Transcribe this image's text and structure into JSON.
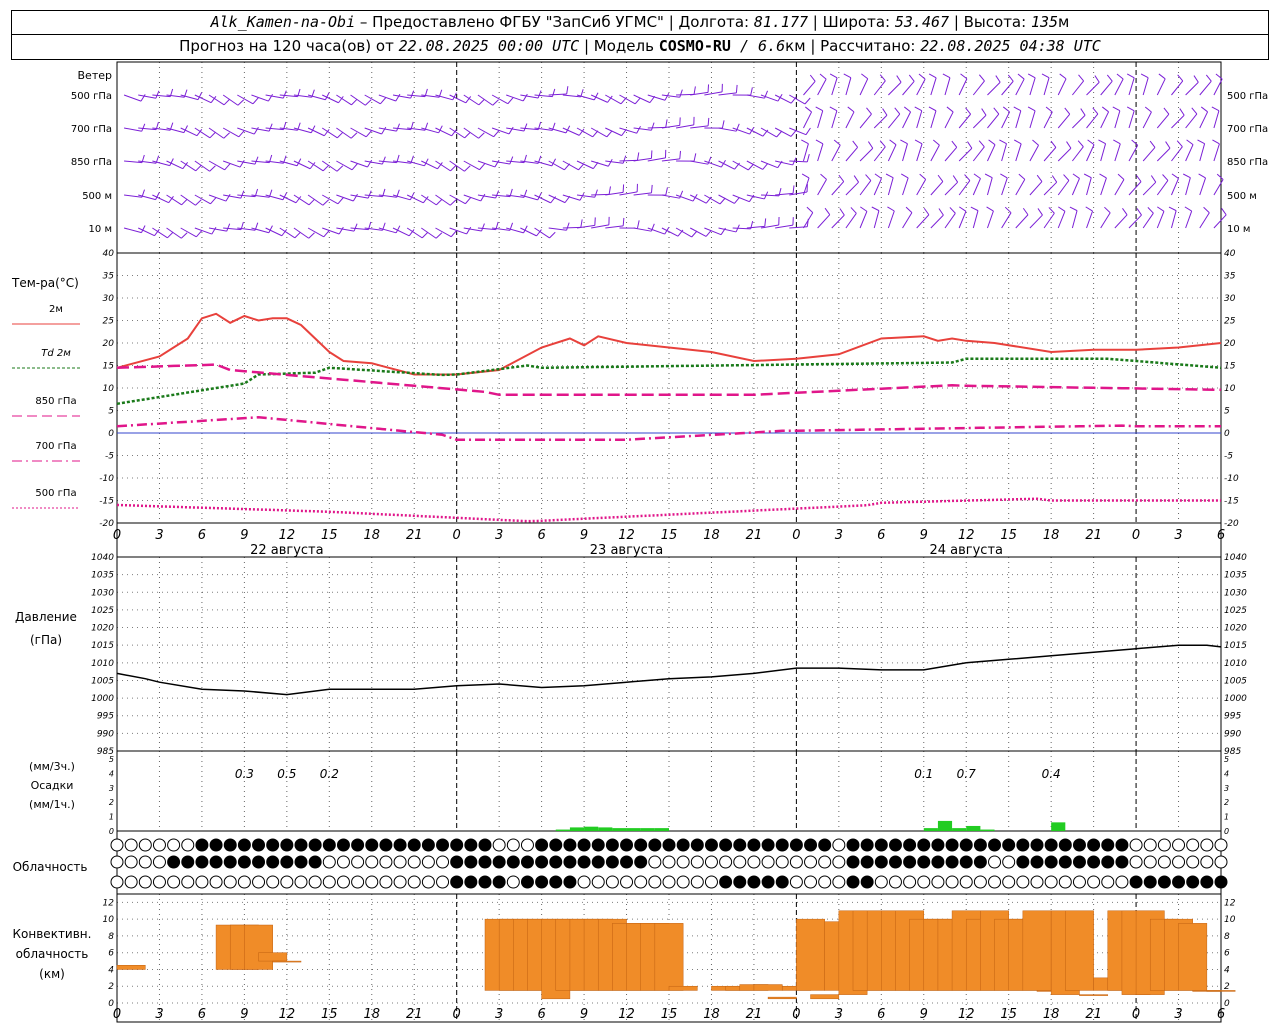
{
  "header": {
    "station": "Alk_Kamen-na-Obi",
    "provided_by": " – Предоставлено ФГБУ \"ЗапСиб УГМС\" | Долгота: ",
    "lon": "81.177",
    "lat_label": " | Широта: ",
    "lat": "53.467",
    "alt_label": " | Высота: ",
    "alt": "135",
    "alt_unit": "м",
    "forecast_label": "Прогноз на 120 часа(ов) от ",
    "forecast_from": "22.08.2025 00:00 UTC",
    "model_label": " | Модель ",
    "model": "COSMO-RU",
    "resolution": " / 6.6",
    "resolution_unit": "км",
    "calc_label": " | Рассчитано: ",
    "calc_time": "22.08.2025 04:38 UTC"
  },
  "wind_panel": {
    "title": "Ветер",
    "levels": [
      "500 гПа",
      "700 гПа",
      "850 гПа",
      "500 м",
      "10  м"
    ],
    "color": "#7b1fd6"
  },
  "temp_panel": {
    "title": "Тем-ра(°C)",
    "legend": [
      {
        "label": "2м",
        "color": "#e8413c",
        "style": "solid"
      },
      {
        "label": "Td  2м",
        "color": "#1a7a1a",
        "style": "dot"
      },
      {
        "label": "850 гПа",
        "color": "#e0168a",
        "style": "dash"
      },
      {
        "label": "700 гПа",
        "color": "#e0168a",
        "style": "dashdot"
      },
      {
        "label": "500 гПа",
        "color": "#e0168a",
        "style": "dotted"
      }
    ]
  },
  "time_axis": {
    "tick_labels": [
      "0",
      "3",
      "6",
      "9",
      "12",
      "15",
      "18",
      "21",
      "0",
      "3",
      "6",
      "9",
      "12",
      "15",
      "18",
      "21",
      "0",
      "3",
      "6",
      "9",
      "12",
      "15",
      "18",
      "21",
      "0",
      "3",
      "6"
    ],
    "days": [
      "22 августа",
      "23 августа",
      "24 августа"
    ]
  },
  "pressure_panel": {
    "title1": "Давление",
    "title2": "(гПа)"
  },
  "precip_panel": {
    "title1": "(мм/3ч.)",
    "title2": "Осадки",
    "title3": "(мм/1ч.)",
    "totals": [
      {
        "label": "0.3",
        "hour": 9
      },
      {
        "label": "0.5",
        "hour": 12
      },
      {
        "label": "0.2",
        "hour": 15
      },
      {
        "label": "0.1",
        "hour": 57
      },
      {
        "label": "0.7",
        "hour": 60
      },
      {
        "label": "0.4",
        "hour": 66
      }
    ],
    "bar_color": "#22cc22"
  },
  "cloud_panel": {
    "title": "Облачность"
  },
  "conv_panel": {
    "title1": "Конвективн.",
    "title2": "облачность",
    "title3": "(км)",
    "bar_color": "#f08c28"
  },
  "chart_data": [
    {
      "type": "line",
      "title": "Тем-ра(°C)",
      "xlabel": "",
      "ylabel": "Тем-ра(°C)",
      "ylim": [
        -20,
        40
      ],
      "x_hours": [
        0,
        3,
        5,
        6,
        7,
        8,
        9,
        10,
        11,
        12,
        13,
        14,
        15,
        16,
        18,
        21,
        24,
        27,
        30,
        32,
        33,
        34,
        36,
        39,
        42,
        45,
        48,
        51,
        54,
        57,
        58,
        59,
        60,
        62,
        66,
        69,
        72,
        75,
        78
      ],
      "series": [
        {
          "name": "2м",
          "color": "#e8413c",
          "values": [
            14.5,
            17,
            21,
            25.5,
            26.5,
            24.5,
            26,
            25,
            25.5,
            25.5,
            24,
            21,
            18,
            16,
            15.5,
            13,
            13,
            14,
            19,
            21,
            19.5,
            21.5,
            20,
            19,
            18,
            16,
            16.5,
            17.5,
            21,
            21.5,
            20.5,
            21,
            20.5,
            20,
            18,
            18.5,
            18.5,
            19,
            20
          ]
        }
      ]
    },
    {
      "type": "line",
      "title": "Давление",
      "ylabel": "Давление (гПа)",
      "ylim": [
        985,
        1040
      ],
      "x": [
        0,
        2,
        3,
        6,
        9,
        12,
        15,
        18,
        21,
        24,
        27,
        30,
        33,
        36,
        39,
        42,
        45,
        48,
        51,
        54,
        57,
        60,
        63,
        66,
        69,
        72,
        75,
        77,
        78
      ],
      "values": [
        1007,
        1005.5,
        1004.5,
        1002.5,
        1002,
        1001,
        1002.5,
        1002.5,
        1002.5,
        1003.5,
        1004,
        1003,
        1003.5,
        1004.5,
        1005.5,
        1006,
        1007,
        1008.5,
        1008.5,
        1008,
        1008,
        1010,
        1011,
        1012,
        1013,
        1014,
        1015,
        1015,
        1014.5
      ]
    },
    {
      "type": "bar",
      "title": "Осадки",
      "ylabel": "(мм/1ч.)",
      "ylim": [
        0,
        5
      ],
      "x": [
        31,
        32,
        33,
        34,
        35,
        36,
        37,
        38,
        57,
        58,
        59,
        60,
        61,
        66
      ],
      "values": [
        0.1,
        0.25,
        0.3,
        0.25,
        0.2,
        0.2,
        0.2,
        0.2,
        0.2,
        0.7,
        0.2,
        0.35,
        0.1,
        0.6
      ]
    },
    {
      "type": "bar",
      "title": "Конвективн. облачность",
      "ylabel": "(км)",
      "ylim": [
        0,
        13
      ],
      "x": [
        0,
        7,
        8,
        9,
        10,
        11,
        26,
        27,
        28,
        29,
        30,
        31,
        32,
        33,
        34,
        35,
        36,
        37,
        38,
        39,
        42,
        43,
        44,
        45,
        46,
        47,
        48,
        49,
        50,
        51,
        52,
        53,
        54,
        55,
        56,
        57,
        58,
        59,
        60,
        61,
        62,
        63,
        64,
        65,
        66,
        67,
        68,
        69,
        70,
        71,
        72,
        73,
        74,
        75,
        76,
        77
      ],
      "base": [
        4,
        4,
        4,
        4,
        5,
        5,
        1.5,
        1.5,
        1.5,
        1.5,
        0.5,
        1.5,
        1.5,
        1.5,
        1.5,
        1.5,
        1.5,
        1.5,
        1.5,
        1.5,
        1.5,
        1.5,
        1.5,
        1.5,
        0.5,
        1.5,
        1.5,
        0.5,
        1.5,
        1,
        1.5,
        1.5,
        1.5,
        1.5,
        1.5,
        1.5,
        1.5,
        1.5,
        1.5,
        1.5,
        1.5,
        1.5,
        1.5,
        1.5,
        1,
        1.5,
        1.5,
        1.5,
        1.5,
        1,
        1,
        1.5,
        1.5,
        1.5,
        1.5,
        1.5
      ],
      "top": [
        4.5,
        9.3,
        9.3,
        9.3,
        6,
        5,
        10,
        10,
        10,
        10,
        10,
        10,
        10,
        10,
        10,
        9.5,
        9.5,
        9.5,
        9.5,
        2,
        2,
        2,
        2.2,
        2.2,
        0.7,
        2,
        10,
        1,
        9.7,
        11,
        11,
        11,
        11,
        11,
        10,
        10,
        10,
        11,
        10,
        11,
        10,
        10,
        11,
        1.5,
        11,
        11,
        1,
        3,
        11,
        11,
        11,
        10,
        10,
        9.5,
        1.5,
        1.5
      ]
    }
  ]
}
